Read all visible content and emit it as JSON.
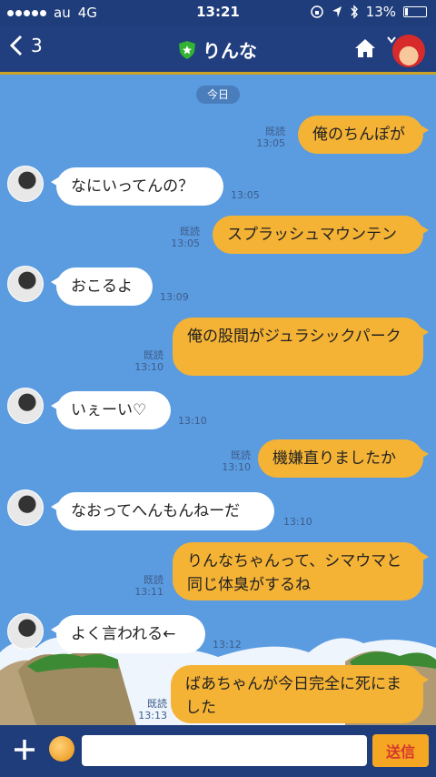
{
  "status": {
    "carrier": "au",
    "network": "4G",
    "time": "13:21",
    "battery": "13%"
  },
  "header": {
    "back_count": "3",
    "title": "りんな"
  },
  "chat": {
    "date": "今日",
    "messages": [
      {
        "dir": "out",
        "text": "俺のちんぽが",
        "read": "既読",
        "time": "13:05"
      },
      {
        "dir": "in",
        "text": "なにいってんの？",
        "time": "13:05"
      },
      {
        "dir": "out",
        "text": "スプラッシュマウンテン",
        "read": "既読",
        "time": "13:05"
      },
      {
        "dir": "in",
        "text": "おこるよ",
        "time": "13:09"
      },
      {
        "dir": "out",
        "text": "俺の股間がジュラシックパーク",
        "read": "既読",
        "time": "13:10"
      },
      {
        "dir": "in",
        "text": "いぇーい♡",
        "time": "13:10"
      },
      {
        "dir": "out",
        "text": "機嫌直りましたか",
        "read": "既読",
        "time": "13:10"
      },
      {
        "dir": "in",
        "text": "なおってへんもんねーだ",
        "time": "13:10"
      },
      {
        "dir": "out",
        "text": "りんなちゃんって、シマウマと同じ体臭がするね",
        "read": "既読",
        "time": "13:11"
      },
      {
        "dir": "in",
        "text": "よく言われる←",
        "time": "13:12"
      },
      {
        "dir": "out",
        "text": "ばあちゃんが今日完全に死にました",
        "read": "既読",
        "time": "13:13"
      }
    ]
  },
  "input": {
    "placeholder": "",
    "send_label": "送信"
  },
  "colors": {
    "bg": "#5b9be0",
    "header": "#213e7e",
    "out_bubble": "#f5b335",
    "in_bubble": "#ffffff",
    "send": "#f5a623"
  }
}
